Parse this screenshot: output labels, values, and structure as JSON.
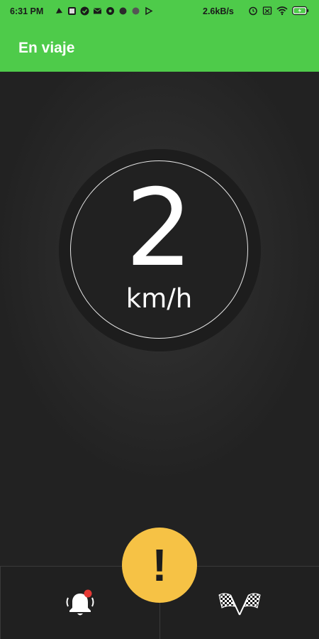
{
  "status_bar": {
    "time": "6:31 PM",
    "network_speed": "2.6kB/s",
    "notification_icons": [
      "notification-icon",
      "gallery-icon",
      "check-icon",
      "mail-icon",
      "settings-icon",
      "dot-icon",
      "dot-icon",
      "play-icon"
    ],
    "system_icons": [
      "alarm-icon",
      "sim-icon",
      "wifi-icon",
      "battery-icon"
    ],
    "battery_color": "#4ecb4a"
  },
  "app_bar": {
    "title": "En viaje",
    "color": "#4ecb4a"
  },
  "speedometer": {
    "value": "2",
    "unit": "km/h"
  },
  "actions": {
    "alerts_icon": "bell-icon",
    "alerts_badge_color": "#e53935",
    "finish_icon": "checkered-flags-icon",
    "alert_fab_label": "!",
    "alert_fab_color": "#f6c245"
  }
}
